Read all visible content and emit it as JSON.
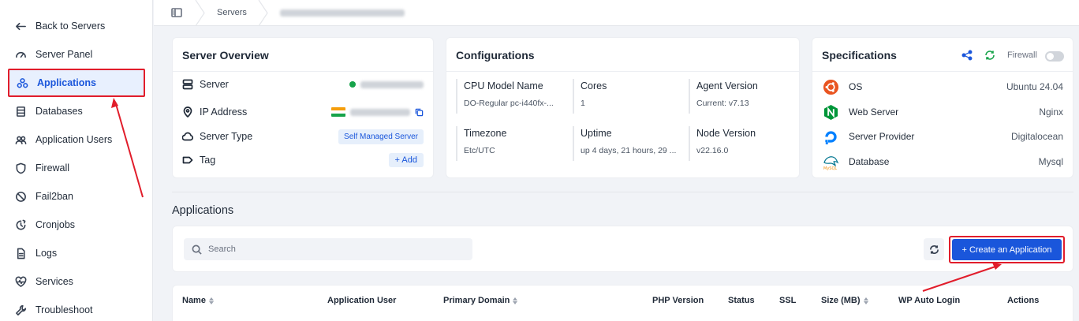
{
  "sidebar": {
    "items": [
      {
        "label": "Back to Servers",
        "icon": "arrow-left-icon"
      },
      {
        "label": "Server Panel",
        "icon": "gauge-icon"
      },
      {
        "label": "Applications",
        "icon": "apps-icon",
        "active": true
      },
      {
        "label": "Databases",
        "icon": "database-icon"
      },
      {
        "label": "Application Users",
        "icon": "users-icon"
      },
      {
        "label": "Firewall",
        "icon": "shield-icon"
      },
      {
        "label": "Fail2ban",
        "icon": "ban-icon"
      },
      {
        "label": "Cronjobs",
        "icon": "clock-icon"
      },
      {
        "label": "Logs",
        "icon": "file-icon"
      },
      {
        "label": "Services",
        "icon": "heartbeat-icon"
      },
      {
        "label": "Troubleshoot",
        "icon": "wrench-icon"
      }
    ]
  },
  "breadcrumb": {
    "servers": "Servers"
  },
  "overview": {
    "title": "Server Overview",
    "server_label": "Server",
    "ip_label": "IP Address",
    "type_label": "Server Type",
    "type_value": "Self Managed Server",
    "tag_label": "Tag",
    "add_label": "+ Add"
  },
  "config": {
    "title": "Configurations",
    "cells": [
      {
        "label": "CPU Model Name",
        "value": "DO-Regular pc-i440fx-..."
      },
      {
        "label": "Cores",
        "value": "1"
      },
      {
        "label": "Agent Version",
        "value": "Current: v7.13"
      },
      {
        "label": "Timezone",
        "value": "Etc/UTC"
      },
      {
        "label": "Uptime",
        "value": "up 4 days, 21 hours, 29 ..."
      },
      {
        "label": "Node Version",
        "value": "v22.16.0"
      }
    ]
  },
  "specs": {
    "title": "Specifications",
    "firewall_label": "Firewall",
    "rows": [
      {
        "label": "OS",
        "value": "Ubuntu 24.04"
      },
      {
        "label": "Web Server",
        "value": "Nginx"
      },
      {
        "label": "Server Provider",
        "value": "Digitalocean"
      },
      {
        "label": "Database",
        "value": "Mysql"
      }
    ]
  },
  "applications": {
    "title": "Applications",
    "search_placeholder": "Search",
    "create_label": "+ Create an Application",
    "columns": [
      {
        "label": "Name",
        "sortable": true
      },
      {
        "label": "Application User",
        "sortable": false
      },
      {
        "label": "Primary Domain",
        "sortable": true
      },
      {
        "label": "PHP Version",
        "sortable": false
      },
      {
        "label": "Status",
        "sortable": false
      },
      {
        "label": "SSL",
        "sortable": false
      },
      {
        "label": "Size (MB)",
        "sortable": true
      },
      {
        "label": "WP Auto Login",
        "sortable": false
      },
      {
        "label": "Actions",
        "sortable": false
      }
    ]
  },
  "colors": {
    "primary": "#1a56db",
    "highlight": "#e11d2b",
    "online": "#16a34a"
  }
}
